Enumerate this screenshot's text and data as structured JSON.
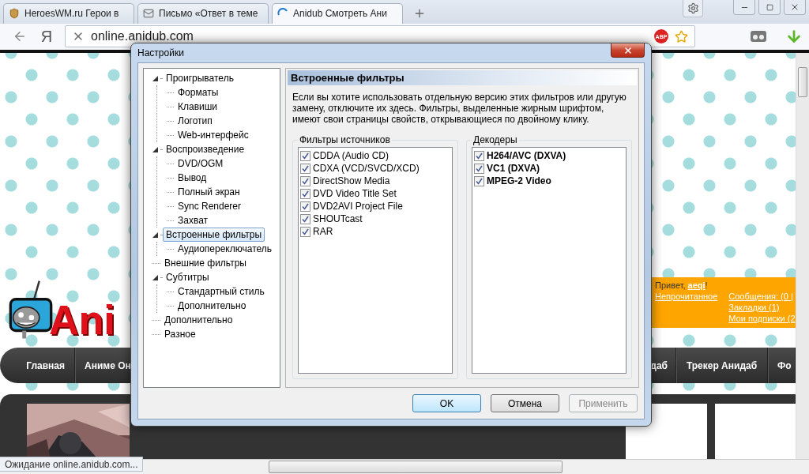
{
  "browser": {
    "tabs": [
      {
        "title": "HeroesWM.ru Герои в",
        "selected": false,
        "loading": false
      },
      {
        "title": "Письмо «Ответ в теме",
        "selected": false,
        "loading": false
      },
      {
        "title": "Anidub Смотреть Ани",
        "selected": true,
        "loading": true
      }
    ],
    "home_logo": "Я",
    "address": {
      "value": "online.anidub.com"
    },
    "adblock_badge": "ABP"
  },
  "page": {
    "logo_text": "Ani",
    "greeting": {
      "prefix": "Привет, ",
      "user": "aeqi",
      "suffix": "!"
    },
    "link_columns": [
      [
        "Непрочитанное"
      ],
      [
        "Сообщения: (0 |",
        "Закладки (1)",
        "Мои подписки (2"
      ]
    ],
    "nav_left": [
      "Главная",
      "Аниме Он"
    ],
    "nav_right": [
      "даб",
      "Трекер Анидаб",
      "Фо"
    ]
  },
  "dialog": {
    "title": "Настройки",
    "tree": [
      {
        "label": "Проигрыватель",
        "selected": false,
        "expanded": true,
        "children": [
          {
            "label": "Форматы",
            "selected": false
          },
          {
            "label": "Клавиши",
            "selected": false
          },
          {
            "label": "Логотип",
            "selected": false
          },
          {
            "label": "Web-интерфейс",
            "selected": false
          }
        ]
      },
      {
        "label": "Воспроизведение",
        "selected": false,
        "expanded": true,
        "children": [
          {
            "label": "DVD/OGM",
            "selected": false
          },
          {
            "label": "Вывод",
            "selected": false
          },
          {
            "label": "Полный экран",
            "selected": false
          },
          {
            "label": "Sync Renderer",
            "selected": false
          },
          {
            "label": "Захват",
            "selected": false
          }
        ]
      },
      {
        "label": "Встроенные фильтры",
        "selected": true,
        "expanded": true,
        "children": [
          {
            "label": "Аудиопереключатель",
            "selected": false
          }
        ]
      },
      {
        "label": "Внешние фильтры",
        "selected": false
      },
      {
        "label": "Субтитры",
        "selected": false,
        "expanded": true,
        "children": [
          {
            "label": "Стандартный стиль",
            "selected": false
          },
          {
            "label": "Дополнительно",
            "selected": false
          }
        ]
      },
      {
        "label": "Дополнительно",
        "selected": false
      },
      {
        "label": "Разное",
        "selected": false
      }
    ],
    "section_title": "Встроенные фильтры",
    "description": "Если вы хотите использовать отдельную версию этих фильтров или другую замену, отключите их здесь. Фильтры, выделенные жирным шрифтом, имеют свои страницы свойств, открывающиеся по двойному клику.",
    "groups": [
      {
        "title": "Фильтры источников",
        "items": [
          {
            "label": "CDDA (Audio CD)",
            "checked": true,
            "bold": false
          },
          {
            "label": "CDXA (VCD/SVCD/XCD)",
            "checked": true,
            "bold": false
          },
          {
            "label": "DirectShow Media",
            "checked": true,
            "bold": false
          },
          {
            "label": "DVD Video Title Set",
            "checked": true,
            "bold": false
          },
          {
            "label": "DVD2AVI Project File",
            "checked": true,
            "bold": false
          },
          {
            "label": "SHOUTcast",
            "checked": true,
            "bold": false
          },
          {
            "label": "RAR",
            "checked": true,
            "bold": false
          }
        ]
      },
      {
        "title": "Декодеры",
        "items": [
          {
            "label": "H264/AVC (DXVA)",
            "checked": true,
            "bold": true
          },
          {
            "label": "VC1 (DXVA)",
            "checked": true,
            "bold": true
          },
          {
            "label": "MPEG-2 Video",
            "checked": true,
            "bold": true
          }
        ]
      }
    ],
    "buttons": [
      {
        "label": "OK",
        "default": true,
        "disabled": false
      },
      {
        "label": "Отмена",
        "default": false,
        "disabled": false
      },
      {
        "label": "Применить",
        "default": false,
        "disabled": true
      }
    ]
  },
  "status_bar": "Ожидание online.anidub.com..."
}
